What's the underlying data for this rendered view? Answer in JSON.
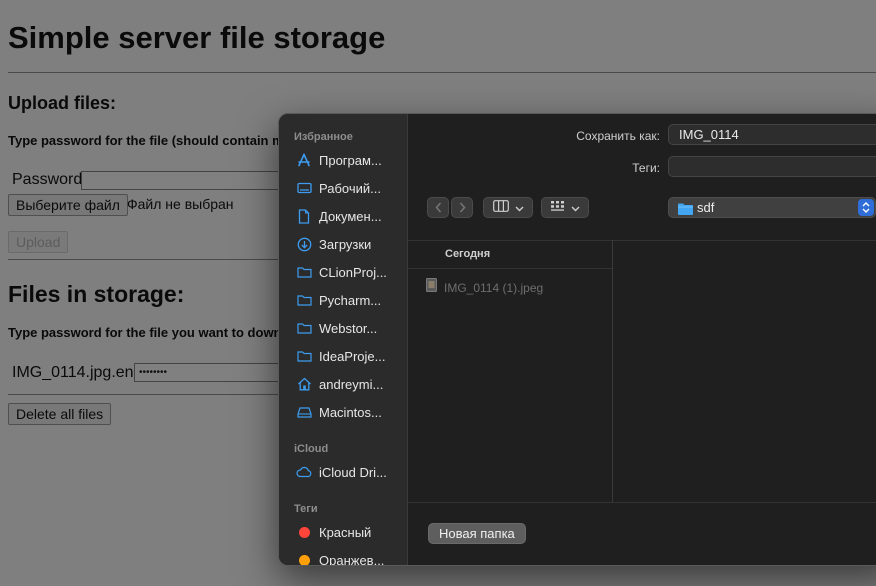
{
  "page": {
    "title": "Simple server file storage",
    "upload_heading": "Upload files:",
    "upload_instruction": "Type password for the file (should contain min",
    "password_label": "Password",
    "choose_file_label": "Выберите файл",
    "no_file_text": "Файл не выбран",
    "upload_button": "Upload",
    "storage_heading": "Files in storage:",
    "storage_instruction": "Type password for the file you want to downloa",
    "file_name": "IMG_0114.jpg.enc",
    "file_password_mask": "••••••••",
    "delete_all_button": "Delete all files"
  },
  "dialog": {
    "save_as_label": "Сохранить как:",
    "save_as_value": "IMG_0114",
    "tags_label": "Теги:",
    "tags_value": "",
    "location": "sdf",
    "column_header": "Сегодня",
    "files": [
      {
        "name": "IMG_0114 (1).jpeg",
        "icon": "image-file-icon"
      }
    ],
    "new_folder_button": "Новая папка",
    "sidebar": {
      "favorites_heading": "Избранное",
      "favorites": [
        {
          "label": "Програм...",
          "icon": "applications-icon"
        },
        {
          "label": "Рабочий...",
          "icon": "desktop-icon"
        },
        {
          "label": "Докумен...",
          "icon": "document-icon"
        },
        {
          "label": "Загрузки",
          "icon": "downloads-icon"
        },
        {
          "label": "CLionProj...",
          "icon": "folder-icon"
        },
        {
          "label": "Pycharm...",
          "icon": "folder-icon"
        },
        {
          "label": "Webstor...",
          "icon": "folder-icon"
        },
        {
          "label": "IdeaProje...",
          "icon": "folder-icon"
        },
        {
          "label": "andreymi...",
          "icon": "home-icon"
        },
        {
          "label": "Macintos...",
          "icon": "disk-icon"
        }
      ],
      "icloud_heading": "iCloud",
      "icloud": [
        {
          "label": "iCloud Dri...",
          "icon": "cloud-icon"
        }
      ],
      "tags_heading": "Теги",
      "tags": [
        {
          "label": "Красный",
          "color": "#ff453a"
        },
        {
          "label": "Оранжев...",
          "color": "#ff9f0a"
        }
      ]
    }
  },
  "colors": {
    "accent_blue": "#2f6ed8",
    "sidebar_icon_blue": "#3d9cf0",
    "folder_blue": "#43a6f2"
  }
}
